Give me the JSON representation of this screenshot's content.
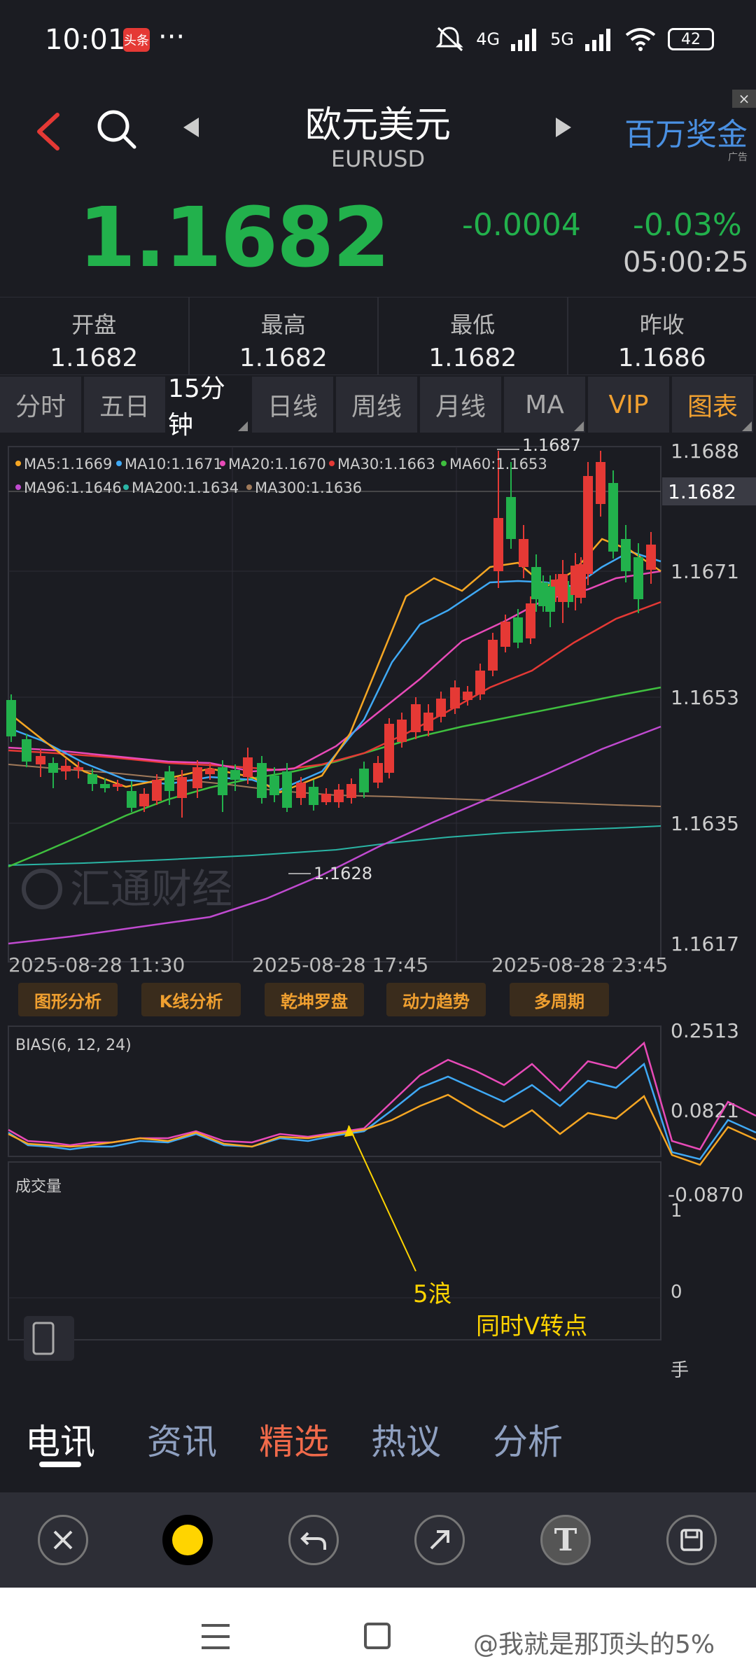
{
  "status": {
    "time": "10:01",
    "badge": "头条",
    "dots": "···",
    "net1": "4G",
    "net2": "5G",
    "battery": "42"
  },
  "header": {
    "title": "欧元美元",
    "subtitle": "EURUSD",
    "ad": "百万奖金",
    "ad_label": "广告",
    "ad_close": "×"
  },
  "quote": {
    "price": "1.1682",
    "arrow": "⬇",
    "change": "-0.0004",
    "percent": "-0.03%",
    "time": "05:00:25"
  },
  "stats": [
    {
      "label": "开盘",
      "value": "1.1682"
    },
    {
      "label": "最高",
      "value": "1.1682"
    },
    {
      "label": "最低",
      "value": "1.1682"
    },
    {
      "label": "昨收",
      "value": "1.1686"
    }
  ],
  "tabs": [
    "分时",
    "五日",
    "15分钟",
    "日线",
    "周线",
    "月线",
    "MA",
    "VIP",
    "图表"
  ],
  "ma_legend": [
    {
      "text": "MA5:1.1669",
      "color": "#f5a623"
    },
    {
      "text": "MA10:1.1671",
      "color": "#3fa9f5"
    },
    {
      "text": "MA20:1.1670",
      "color": "#e84ab8"
    },
    {
      "text": "MA30:1.1663",
      "color": "#e53935"
    },
    {
      "text": "MA60:1.1653",
      "color": "#3fbf3f"
    },
    {
      "text": "MA96:1.1646",
      "color": "#c04ad0"
    },
    {
      "text": "MA200:1.1634",
      "color": "#2ab5a5"
    },
    {
      "text": "MA300:1.1636",
      "color": "#a07a5a"
    }
  ],
  "price_axis": [
    "1.1688",
    "1.1682",
    "1.1671",
    "1.1653",
    "1.1635",
    "1.1617"
  ],
  "time_axis": [
    "2025-08-28 11:30",
    "2025-08-28 17:45",
    "2025-08-28 23:45"
  ],
  "high_label": "1.1687",
  "low_label": "1.1628",
  "chart_watermark": "汇通财经",
  "tools": [
    "图形分析",
    "K线分析",
    "乾坤罗盘",
    "动力趋势",
    "多周期"
  ],
  "bias": {
    "title": "BIAS(6, 12, 24)",
    "axis": [
      "0.2513",
      "0.0821",
      "-0.0870"
    ]
  },
  "volume": {
    "title": "成交量",
    "axis": [
      "1",
      "0",
      "手"
    ]
  },
  "annotations": {
    "wave": "5浪",
    "note": "同时V转点"
  },
  "news_tabs": [
    "电讯",
    "资讯",
    "精选",
    "热议",
    "分析"
  ],
  "toolbar": {
    "text_tool": "T"
  },
  "watermark": "@我就是那顶头的5%"
}
